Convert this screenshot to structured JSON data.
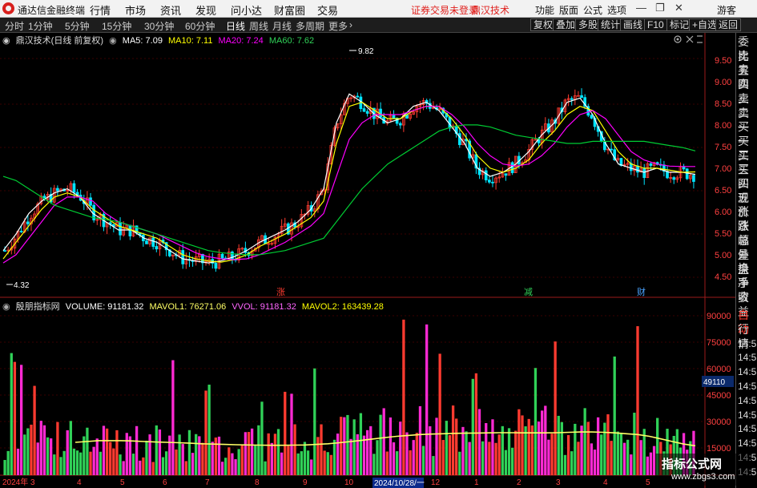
{
  "menubar": {
    "app_title": "通达信金融终端",
    "menus": [
      "行情",
      "市场",
      "资讯",
      "发现",
      "问小达",
      "财富圈",
      "交易"
    ],
    "login_notice": "证券交易未登录",
    "brand": "鼎汉技术",
    "right_items": [
      "功能",
      "版面",
      "公式",
      "选项"
    ],
    "guest": "游客"
  },
  "toolbar": {
    "periods": [
      "分时",
      "1分钟",
      "5分钟",
      "15分钟",
      "30分钟",
      "60分钟",
      "日线",
      "周线",
      "月线",
      "多周期",
      "更多"
    ],
    "active_period": "日线",
    "buttons": [
      "复权",
      "叠加",
      "多股",
      "统计",
      "画线",
      "F10",
      "标记",
      "+自选",
      "返回"
    ]
  },
  "price_chart": {
    "title": "鼎汉技术(日线 前复权)",
    "ma5": "MA5: 7.09",
    "ma10": "MA10: 7.11",
    "ma20": "MA20: 7.24",
    "ma60": "MA60: 7.62",
    "high_label": "9.82",
    "low_label": "4.32",
    "markers": [
      "涨",
      "减",
      "财"
    ],
    "y_ticks": [
      "9.50",
      "9.00",
      "8.50",
      "8.00",
      "7.50",
      "7.00",
      "6.50",
      "6.00",
      "5.50",
      "5.00",
      "4.50"
    ]
  },
  "volume_chart": {
    "title": "殷朋指标网",
    "volume": "VOLUME: 91181.32",
    "mavol1": "MAVOL1: 76271.06",
    "vvol": "VVOL: 91181.32",
    "mavol2": "MAVOL2: 163439.28",
    "y_ticks": [
      "90000",
      "75000",
      "60000",
      "45000",
      "30000",
      "15000"
    ],
    "current_value": "49110"
  },
  "x_axis": {
    "labels": [
      "2024年",
      "3",
      "4",
      "5",
      "6",
      "7",
      "8",
      "9",
      "10",
      "12",
      "1",
      "2",
      "3",
      "4",
      "5"
    ],
    "cursor_label": "2024/10/28/一"
  },
  "side_panel": {
    "top_items": [
      "委比",
      "卖五",
      "卖四",
      "卖三",
      "卖二",
      "卖一",
      "买一",
      "买二",
      "买三",
      "买四",
      "买五",
      "现价",
      "涨跌",
      "涨幅",
      "总量",
      "外盘",
      "换手",
      "净资",
      "收益"
    ],
    "bottom_items": [
      "自动",
      "行情",
      "14:56",
      "14:56",
      "14:56",
      "14:56",
      "14:56",
      "14:56",
      "14:56",
      "14:56",
      "14:56",
      "14:56"
    ]
  },
  "watermark": {
    "line1": "指标公式网",
    "line2": "www.zbgs3.com"
  },
  "colors": {
    "up": "#ff3b30",
    "down": "#30d158",
    "pink": "#ff2ad4",
    "ma5": "#ffffff",
    "ma10": "#ffff00",
    "ma20": "#ff00ff",
    "ma60": "#00cc33",
    "mavol": "#ffff66"
  },
  "chart_data": [
    {
      "type": "candlestick",
      "title": "鼎汉技术(日线 前复权)",
      "ylim": [
        4.3,
        9.9
      ],
      "x_range": [
        "2024年",
        "5"
      ],
      "series": [
        {
          "name": "MA5",
          "values": [
            5.2,
            5.6,
            6.1,
            6.4,
            6.6,
            6.7,
            6.5,
            6.1,
            5.9,
            5.7,
            5.7,
            5.5,
            5.4,
            5.2,
            5.0,
            4.95,
            4.9,
            4.95,
            5.05,
            5.2,
            5.4,
            5.55,
            5.7,
            5.9,
            6.2,
            6.7,
            8.3,
            9.0,
            8.8,
            8.5,
            8.3,
            8.4,
            8.7,
            8.8,
            8.6,
            8.2,
            7.8,
            7.2,
            7.0,
            7.1,
            7.3,
            7.6,
            8.0,
            8.3,
            8.8,
            8.9,
            8.5,
            7.8,
            7.3,
            7.2,
            7.1,
            7.2,
            7.1,
            7.1,
            7.05
          ]
        },
        {
          "name": "MA10",
          "values": [
            5.0,
            5.4,
            5.8,
            6.2,
            6.5,
            6.6,
            6.5,
            6.2,
            6.0,
            5.8,
            5.7,
            5.6,
            5.5,
            5.3,
            5.1,
            5.0,
            4.95,
            4.92,
            4.98,
            5.1,
            5.3,
            5.45,
            5.6,
            5.8,
            6.0,
            6.4,
            7.8,
            8.7,
            8.8,
            8.6,
            8.4,
            8.4,
            8.6,
            8.7,
            8.7,
            8.4,
            8.0,
            7.5,
            7.2,
            7.1,
            7.2,
            7.4,
            7.8,
            8.1,
            8.5,
            8.7,
            8.6,
            8.1,
            7.6,
            7.3,
            7.2,
            7.2,
            7.15,
            7.1,
            7.11
          ]
        },
        {
          "name": "MA20",
          "values": [
            4.9,
            5.1,
            5.5,
            5.9,
            6.3,
            6.5,
            6.5,
            6.4,
            6.1,
            5.9,
            5.8,
            5.7,
            5.6,
            5.45,
            5.3,
            5.15,
            5.05,
            5.0,
            4.98,
            5.0,
            5.1,
            5.25,
            5.4,
            5.6,
            5.8,
            6.1,
            7.0,
            7.9,
            8.3,
            8.5,
            8.5,
            8.5,
            8.6,
            8.7,
            8.7,
            8.5,
            8.2,
            7.8,
            7.5,
            7.3,
            7.25,
            7.3,
            7.5,
            7.8,
            8.2,
            8.5,
            8.6,
            8.4,
            8.0,
            7.6,
            7.4,
            7.3,
            7.25,
            7.24,
            7.24
          ]
        },
        {
          "name": "MA60",
          "values": [
            7.0,
            6.9,
            6.7,
            6.5,
            6.3,
            6.2,
            6.1,
            6.0,
            5.95,
            5.9,
            5.8,
            5.7,
            5.6,
            5.5,
            5.4,
            5.3,
            5.2,
            5.15,
            5.12,
            5.1,
            5.1,
            5.15,
            5.2,
            5.3,
            5.4,
            5.5,
            5.9,
            6.3,
            6.7,
            7.0,
            7.3,
            7.5,
            7.7,
            7.9,
            8.1,
            8.2,
            8.25,
            8.25,
            8.2,
            8.1,
            8.0,
            7.95,
            7.9,
            7.85,
            7.8,
            7.8,
            7.85,
            7.85,
            7.85,
            7.85,
            7.85,
            7.8,
            7.75,
            7.7,
            7.62
          ]
        }
      ]
    },
    {
      "type": "bar",
      "title": "殷朋指标网",
      "ylim": [
        0,
        96000
      ],
      "series": [
        {
          "name": "MAVOL2",
          "values": [
            19000,
            19500,
            20000,
            20000,
            20000,
            19800,
            19500,
            19200,
            19000,
            18800,
            18500,
            18200,
            18000,
            17800,
            17600,
            17500,
            17400,
            17300,
            17300,
            17400,
            17500,
            17800,
            18200,
            18800,
            19500,
            20200,
            21000,
            21800,
            22500,
            23000,
            23500,
            23800,
            24000,
            24200,
            24300,
            24400,
            24500,
            24600,
            24600,
            24500,
            24500,
            24500,
            24600,
            24800,
            25000,
            25000,
            24800,
            24500,
            24000,
            23500,
            22500,
            21000,
            19500,
            18000,
            17000
          ]
        }
      ]
    }
  ]
}
